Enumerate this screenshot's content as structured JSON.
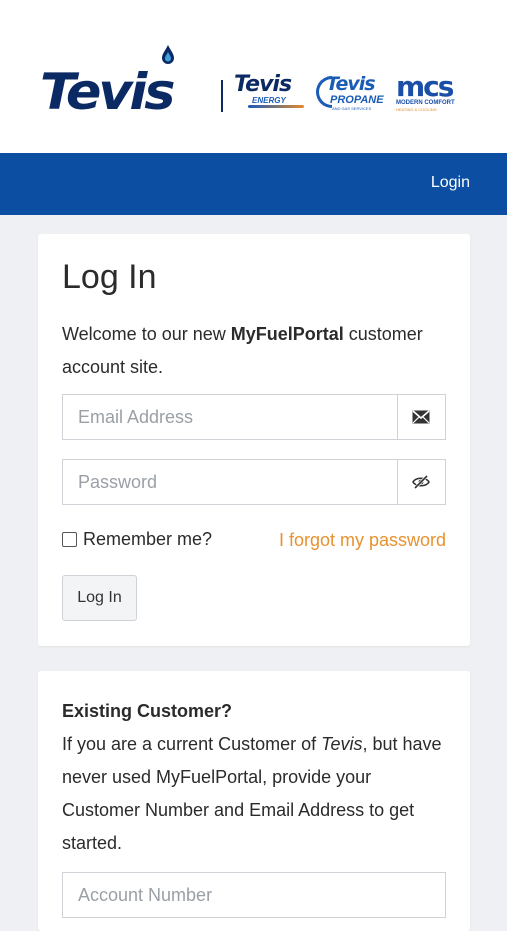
{
  "header": {
    "brand_main": "Tevis",
    "brands": [
      {
        "word": "Tevis",
        "tag": "ENERGY"
      },
      {
        "word": "Tevis",
        "tag": "PROPANE",
        "sub": "AND GAS SERVICES"
      },
      {
        "word": "mcs",
        "tag": "MODERN COMFORT",
        "sub": "HEATING & COOLING"
      }
    ]
  },
  "nav": {
    "login_label": "Login"
  },
  "login_card": {
    "title": "Log In",
    "welcome_prefix": "Welcome to our new ",
    "welcome_brand": "MyFuelPortal",
    "welcome_suffix": " customer account site.",
    "email_placeholder": "Email Address",
    "password_placeholder": "Password",
    "remember_label": "Remember me?",
    "forgot_label": "I forgot my password",
    "submit_label": "Log In"
  },
  "existing_card": {
    "title": "Existing Customer?",
    "body_prefix": "If you are a current Customer of ",
    "body_company": "Tevis",
    "body_suffix": ", but have never used MyFuelPortal, provide your Customer Number and Email Address to get started.",
    "account_placeholder": "Account Number"
  },
  "colors": {
    "nav_bg": "#0b4ea2",
    "brand_navy": "#0b2a63",
    "link_orange": "#e8922f",
    "page_bg": "#eef0f3"
  },
  "icons": [
    "water-drop-icon",
    "envelope-icon",
    "eye-slash-icon"
  ]
}
